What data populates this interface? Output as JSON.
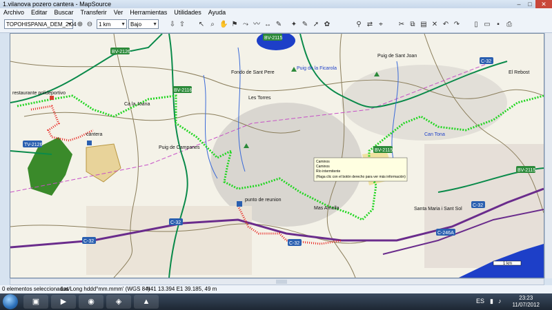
{
  "window": {
    "title": "1.vilanova pozero cantera - MapSource"
  },
  "menu": [
    "Archivo",
    "Editar",
    "Buscar",
    "Transferir",
    "Ver",
    "Herramientas",
    "Utilidades",
    "Ayuda"
  ],
  "toolbar": {
    "map_product": "TOPOHISPANIA_DEM_2.04",
    "zoom": "1 km",
    "detail": "Bajo"
  },
  "map": {
    "colors": {
      "route_green": "#22d622",
      "route_red": "#e8221d",
      "motorway": "#6a2c8c",
      "primary": "#0a8a4a",
      "water": "#1d3fc8"
    },
    "road_badges": [
      {
        "label": "BV-2126",
        "color": "green"
      },
      {
        "label": "BV-2116",
        "color": "green"
      },
      {
        "label": "BV-2115",
        "color": "green"
      },
      {
        "label": "BV-2115",
        "color": "green"
      },
      {
        "label": "BV-2115",
        "color": "green"
      },
      {
        "label": "C-32",
        "color": "blue"
      },
      {
        "label": "C-32",
        "color": "blue"
      },
      {
        "label": "C-32",
        "color": "blue"
      },
      {
        "label": "C-32",
        "color": "blue"
      },
      {
        "label": "C-32",
        "color": "blue"
      },
      {
        "label": "C-246A",
        "color": "blue"
      },
      {
        "label": "TV-2126",
        "color": "blue"
      }
    ],
    "places": [
      "restaurante polideportivo",
      "cantera",
      "punto de reunion",
      "Mas Arnolla",
      "Puig de la Ficarola",
      "Santa Maria i Sant Sol",
      "Fondo de Sant Pere",
      "Puig de Sant Joan",
      "El Rebost",
      "Ca la Joana",
      "Les Torres",
      "Puig de Campanes",
      "Can Tona"
    ],
    "tooltip": [
      "Caminos",
      "Caminos",
      "Río intermitente",
      "(Haga clic con el botón derecho para ver más información)"
    ],
    "scale_label": "1 km"
  },
  "status": {
    "selection": "0 elementos seleccionados",
    "format": "Lat/Long hddd°mm.mmm' (WGS 84)",
    "coords": "N41 13.394 E1 39.185, 49 m"
  },
  "taskbar": {
    "time": "23:23",
    "date": "11/07/2012",
    "lang": "ES"
  }
}
